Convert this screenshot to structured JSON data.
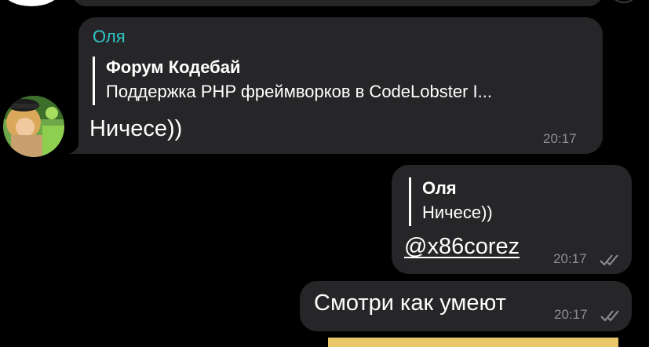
{
  "chat": {
    "messages": [
      {
        "sender": "Оля",
        "reply": {
          "title": "Форум Кодебай",
          "text": "Поддержка PHP фреймворков в CodeLobster I..."
        },
        "text": "Ничесе))",
        "time": "20:17"
      },
      {
        "reply": {
          "title": "Оля",
          "text": "Ничесе))"
        },
        "text": "@x86corez",
        "time": "20:17"
      },
      {
        "text": "Смотри как умеют",
        "time": "20:17"
      }
    ]
  },
  "colors": {
    "background": "#000000",
    "bubble": "#262628",
    "sender_name": "#30c6c6",
    "timestamp": "#8e8e93"
  },
  "icons": {
    "read_status": "double-check-icon",
    "avatar": "user-avatar"
  }
}
